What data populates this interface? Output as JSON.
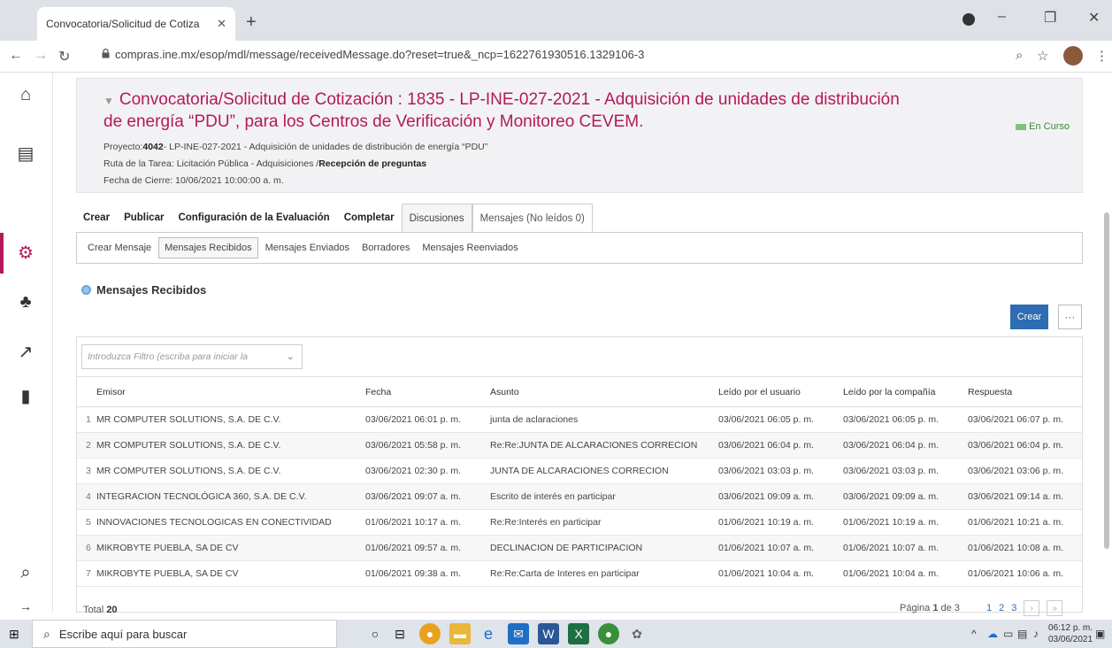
{
  "browser": {
    "tab_title": "Convocatoria/Solicitud de Cotiza",
    "url": "compras.ine.mx/esop/mdl/message/receivedMessage.do?reset=true&_ncp=1622761930516.1329106-3"
  },
  "header": {
    "title": "Convocatoria/Solicitud de Cotización : 1835 - LP-INE-027-2021 - Adquisición de unidades de distribución de energía “PDU”, para los Centros de Verificación y Monitoreo CEVEM.",
    "proyecto_label": "Proyecto:",
    "proyecto_num": "4042",
    "proyecto_text": "- LP-INE-027-2021 - Adquisición de unidades de distribución de energía “PDU”",
    "ruta_label": "Ruta de la Tarea: Licitación Pública - Adquisiciones /",
    "ruta_bold": "Recepción de preguntas",
    "fecha_cierre": "Fecha de Cierre: 10/06/2021 10:00:00 a. m.",
    "status": "En Curso"
  },
  "tabs": {
    "crear": "Crear",
    "publicar": "Publicar",
    "configuracion": "Configuración de la Evaluación",
    "completar": "Completar",
    "discusiones": "Discusiones",
    "mensajes": "Mensajes (No leídos 0)"
  },
  "subtabs": {
    "crear_mensaje": "Crear Mensaje",
    "recibidos": "Mensajes Recibidos",
    "enviados": "Mensajes Enviados",
    "borradores": "Borradores",
    "reenviados": "Mensajes Reenviados"
  },
  "section_title": "Mensajes Recibidos",
  "actions": {
    "crear": "Crear",
    "more": "···"
  },
  "filter_placeholder": "Introduzca Filtro (escriba para iniciar la",
  "table": {
    "headers": [
      "Emisor",
      "Fecha",
      "Asunto",
      "Leído por el usuario",
      "Leído por la compañía",
      "Respuesta"
    ],
    "rows": [
      [
        "1",
        "MR COMPUTER SOLUTIONS, S.A. DE C.V.",
        "03/06/2021 06:01 p. m.",
        "junta de aclaraciones",
        "03/06/2021 06:05 p. m.",
        "03/06/2021 06:05 p. m.",
        "03/06/2021 06:07 p. m."
      ],
      [
        "2",
        "MR COMPUTER SOLUTIONS, S.A. DE C.V.",
        "03/06/2021 05:58 p. m.",
        "Re:Re:JUNTA DE ALCARACIONES CORRECION",
        "03/06/2021 06:04 p. m.",
        "03/06/2021 06:04 p. m.",
        "03/06/2021 06:04 p. m."
      ],
      [
        "3",
        "MR COMPUTER SOLUTIONS, S.A. DE C.V.",
        "03/06/2021 02:30 p. m.",
        "JUNTA DE ALCARACIONES CORRECION",
        "03/06/2021 03:03 p. m.",
        "03/06/2021 03:03 p. m.",
        "03/06/2021 03:06 p. m."
      ],
      [
        "4",
        "INTEGRACION TECNOLÓGICA 360, S.A. DE C.V.",
        "03/06/2021 09:07 a. m.",
        "Escrito de interés en participar",
        "03/06/2021 09:09 a. m.",
        "03/06/2021 09:09 a. m.",
        "03/06/2021 09:14 a. m."
      ],
      [
        "5",
        "INNOVACIONES TECNOLOGICAS EN CONECTIVIDAD",
        "01/06/2021 10:17 a. m.",
        "Re:Re:Interés en participar",
        "01/06/2021 10:19 a. m.",
        "01/06/2021 10:19 a. m.",
        "01/06/2021 10:21 a. m."
      ],
      [
        "6",
        "MIKROBYTE PUEBLA, SA DE CV",
        "01/06/2021 09:57 a. m.",
        "DECLINACION DE PARTICIPACION",
        "01/06/2021 10:07 a. m.",
        "01/06/2021 10:07 a. m.",
        "01/06/2021 10:08 a. m."
      ],
      [
        "7",
        "MIKROBYTE PUEBLA, SA DE CV",
        "01/06/2021 09:38 a. m.",
        "Re:Re:Carta de Interes en participar",
        "01/06/2021 10:04 a. m.",
        "01/06/2021 10:04 a. m.",
        "01/06/2021 10:06 a. m."
      ]
    ]
  },
  "footer": {
    "total_label": "Total",
    "total_value": "20",
    "page_label": "Página",
    "page_current": "1",
    "page_of": "de 3",
    "pages": [
      "1",
      "2",
      "3"
    ]
  },
  "taskbar": {
    "search_placeholder": "Escribe aquí para buscar",
    "time": "06:12 p. m.",
    "date": "03/06/2021"
  },
  "colors": {
    "brand": "#b3195a",
    "primary": "#2e6cb3",
    "status_green": "#3b8a3b"
  }
}
